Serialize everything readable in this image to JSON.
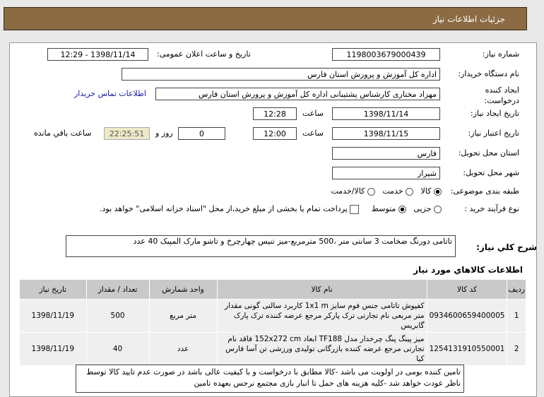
{
  "header": {
    "title": "جزئیات اطلاعات نیاز"
  },
  "form": {
    "need_number_label": "شماره نیاز:",
    "need_number": "1198003679000439",
    "announce_label": "تاریخ و ساعت اعلان عمومی:",
    "announce_value": "1398/11/14 - 12:29",
    "buyer_label": "نام دستگاه خریدار:",
    "buyer": "اداره کل آموزش و پرورش استان فارس",
    "creator_label": "ایجاد کننده درخواست:",
    "creator": "مهزاد  مختاری  کارشناس پشتیبانی اداره کل آموزش و پرورش استان فارس",
    "contact_link": "اطلاعات تماس خریدار",
    "created_label": "تاریخ ایجاد نیاز:",
    "created_date": "1398/11/14",
    "time_label": "ساعت",
    "created_time": "12:28",
    "valid_label": "تاریخ اعتبار نیاز:",
    "valid_date": "1398/11/15",
    "valid_time": "12:00",
    "days": "0",
    "days_label": "روز و",
    "remaining": "22:25:51",
    "remaining_label": "ساعت باقي مانده",
    "province_label": "استان محل تحویل:",
    "province": "فارس",
    "city_label": "شهر محل تحویل:",
    "city": "شیراز",
    "category_label": "طبقه بندی موضوعی:",
    "category_options": [
      "کالا",
      "خدمت",
      "کالا/خدمت"
    ],
    "category_selected": "کالا",
    "process_label": "نوع فرآیند خرید :",
    "process_options": [
      "جزیی",
      "متوسط"
    ],
    "process_selected": "متوسط",
    "payment_note": "پرداخت تمام یا بخشی از مبلغ خرید،از محل \"اسناد خزانه اسلامی\" خواهد بود."
  },
  "description": {
    "label": "شرح کلي نياز:",
    "text": "تاتامی دورنگ ضخامت 3 سانتی متر ،500 مترمربع-میز تنیس چهارچرخ و تاشو مارک المپیک 40 عدد"
  },
  "goods": {
    "title": "اطلاعات کالاهاي مورد نياز",
    "columns": [
      "ردیف",
      "کد کالا",
      "نام کالا",
      "واحد شمارش",
      "تعداد / مقدار",
      "تاریخ نیاز"
    ],
    "rows": [
      {
        "idx": "1",
        "code": "0934600659400005",
        "name": "کفپوش تاتامی جنس فوم سایز 1x1 m کاربرد سالنی گونی مقدار متر مربعی نام تجارتی ترک پارکر مرجع عرضه کننده ترک پارک گابریس",
        "unit": "متر مربع",
        "qty": "500",
        "date": "1398/11/19"
      },
      {
        "idx": "2",
        "code": "1254131910550001",
        "name": "میز پینگ پنگ چرخدار مدل TF188 ابعاد 152x272 cm فاقد نام تجارتی مرجع عرضه کننده بازرگانی تولیدی ورزشی تن آسا فارس کیا",
        "unit": "عدد",
        "qty": "40",
        "date": "1398/11/19"
      }
    ]
  },
  "notes": {
    "text": "تامین کننده بومی در اولویت می باشد -کالا مطابق با درخواست و با کیفیت عالی باشد در صورت عدم تایید کالا توسط ناظر عودت خواهد شد -کلیه هزینه های حمل تا انبار بازی مجتمع نرجس بعهده تامین"
  }
}
